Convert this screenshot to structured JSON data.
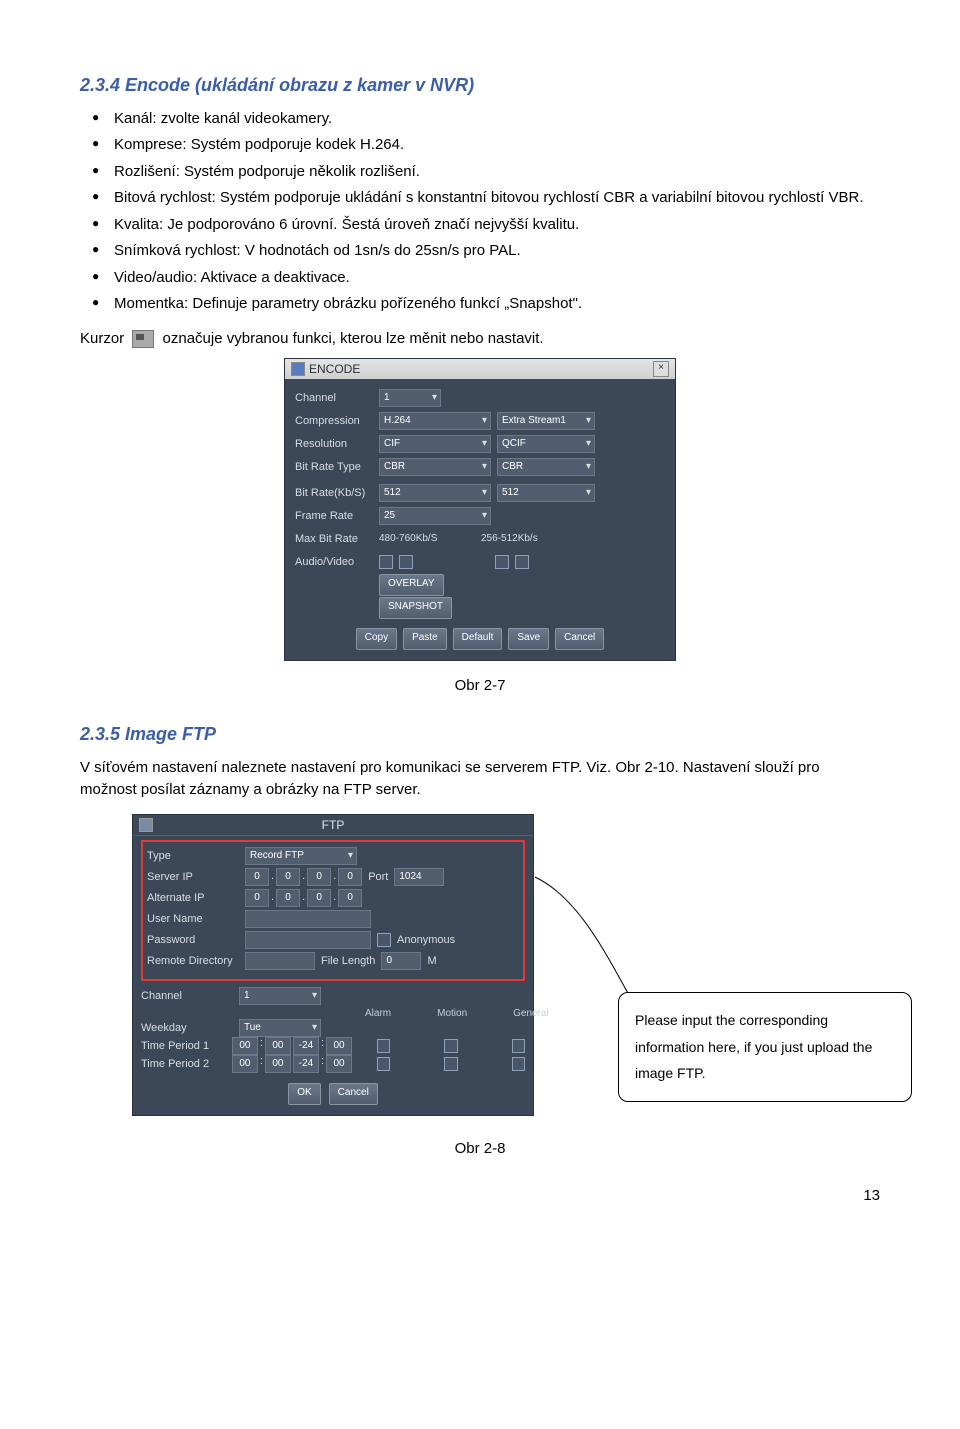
{
  "section1": {
    "title": "2.3.4  Encode (ukládání obrazu z kamer v NVR)",
    "bullets": [
      "Kanál: zvolte kanál videokamery.",
      "Komprese: Systém podporuje kodek H.264.",
      "Rozlišení: Systém podporuje několik rozlišení.",
      "Bitová rychlost: Systém podporuje ukládání s konstantní bitovou rychlostí CBR a variabilní bitovou rychlostí VBR.",
      "Kvalita: Je podporováno 6 úrovní. Šestá úroveň značí nejvyšší kvalitu.",
      "Snímková rychlost: V hodnotách od 1sn/s do 25sn/s pro PAL.",
      "Video/audio: Aktivace a deaktivace.",
      "Momentka: Definuje parametry obrázku pořízeného funkcí „Snapshot\"."
    ],
    "cursor_pre": "Kurzor",
    "cursor_post": "označuje vybranou funkci, kterou lze měnit nebo nastavit."
  },
  "encode": {
    "title": "ENCODE",
    "close": "×",
    "labels": {
      "channel": "Channel",
      "compression": "Compression",
      "resolution": "Resolution",
      "bitratetype": "Bit Rate Type",
      "bitrate": "Bit Rate(Kb/S)",
      "framerate": "Frame Rate",
      "maxbitrate": "Max Bit Rate",
      "audiovideo": "Audio/Video"
    },
    "values": {
      "channel": "1",
      "compression": "H.264",
      "extrastream": "Extra Stream1",
      "resolution": "CIF",
      "resolution2": "QCIF",
      "brtype": "CBR",
      "brtype2": "CBR",
      "bitrate": "512",
      "bitrate2": "512",
      "framerate": "25",
      "maxbitrate": "480-760Kb/S",
      "maxbitrate2": "256-512Kb/s"
    },
    "buttons": {
      "overlay": "OVERLAY",
      "snapshot": "SNAPSHOT",
      "copy": "Copy",
      "paste": "Paste",
      "default": "Default",
      "save": "Save",
      "cancel": "Cancel"
    }
  },
  "fig1": "Obr 2-7",
  "section2": {
    "title": "2.3.5  Image FTP",
    "p1": "V síťovém nastavení naleznete nastavení pro komunikaci se serverem FTP. Viz. Obr 2-10. Nastavení slouží pro možnost posílat záznamy a obrázky na FTP server."
  },
  "ftp": {
    "title": "FTP",
    "labels": {
      "type": "Type",
      "serverip": "Server IP",
      "altip": "Alternate IP",
      "username": "User Name",
      "password": "Password",
      "remote": "Remote Directory",
      "port": "Port",
      "anon": "Anonymous",
      "filelen": "File Length",
      "unitM": "M",
      "channel": "Channel",
      "weekday": "Weekday",
      "tp1": "Time Period 1",
      "tp2": "Time Period 2",
      "alarm": "Alarm",
      "motion": "Motion",
      "general": "General"
    },
    "values": {
      "type": "Record FTP",
      "ip0": "0",
      "ip1": "0",
      "ip2": "0",
      "ip3": "0",
      "port": "1024",
      "filelen": "0",
      "channel": "1",
      "weekday": "Tue",
      "t1a": "00",
      "t1b": "00",
      "t1c": "-24",
      "t1d": "00",
      "t2a": "00",
      "t2b": "00",
      "t2c": "-24",
      "t2d": "00"
    },
    "buttons": {
      "ok": "OK",
      "cancel": "Cancel"
    }
  },
  "callout": "Please input the corresponding information here, if you just upload the image FTP.",
  "fig2": "Obr 2-8",
  "pagenum": "13"
}
